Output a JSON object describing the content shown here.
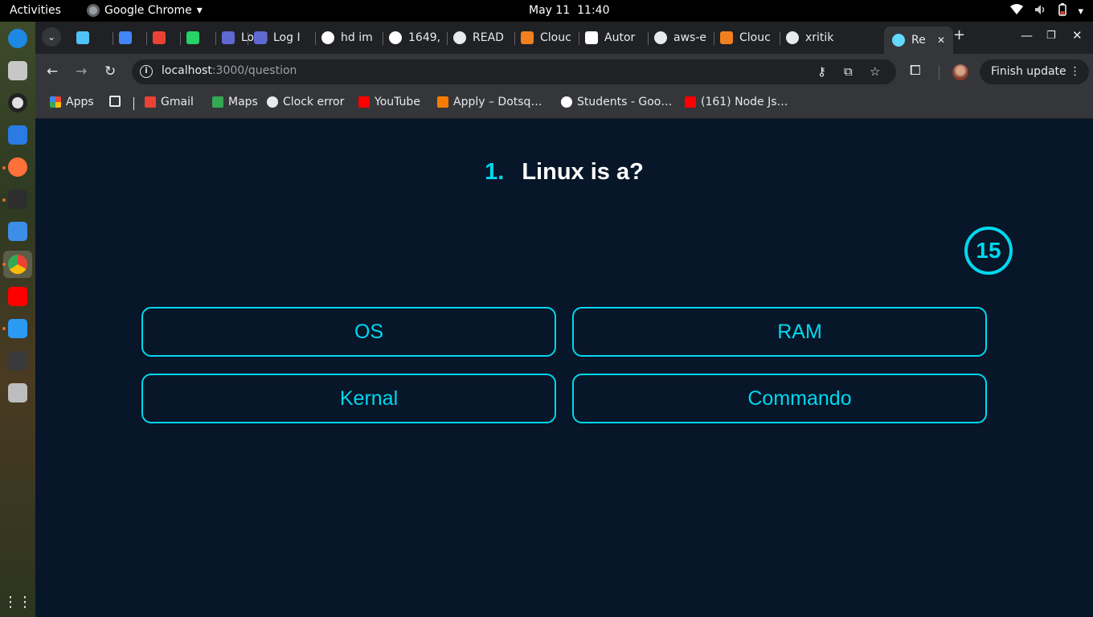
{
  "topbar": {
    "activities": "Activities",
    "app_name": "Google Chrome",
    "date": "May 11",
    "time": "11:40"
  },
  "tabs": [
    {
      "label": "",
      "icon": "weather-icon",
      "color": "#4fc3f7"
    },
    {
      "label": "",
      "icon": "calendar-icon",
      "color": "#4285f4"
    },
    {
      "label": "",
      "icon": "gmail-icon",
      "color": "#ea4335"
    },
    {
      "label": "",
      "icon": "whatsapp-icon",
      "color": "#25d366"
    },
    {
      "label": "Log I",
      "icon": "linear-icon",
      "color": "#5e6ad2"
    },
    {
      "label": "Log I",
      "icon": "linear-icon",
      "color": "#5e6ad2"
    },
    {
      "label": "hd im",
      "icon": "google-icon",
      "color": "#ffffff"
    },
    {
      "label": "1649,",
      "icon": "google-icon",
      "color": "#ffffff"
    },
    {
      "label": "READ",
      "icon": "openai-icon",
      "color": "#e8eaed"
    },
    {
      "label": "Clouc",
      "icon": "cloudflare-icon",
      "color": "#f38020"
    },
    {
      "label": "Autor",
      "icon": "medium-icon",
      "color": "#ffffff"
    },
    {
      "label": "aws-e",
      "icon": "github-icon",
      "color": "#e8eaed"
    },
    {
      "label": "Clouc",
      "icon": "cloudflare-icon",
      "color": "#f38020"
    },
    {
      "label": "xritik",
      "icon": "github-icon",
      "color": "#e8eaed"
    },
    {
      "label": "Re",
      "icon": "react-icon",
      "color": "#61dafb"
    }
  ],
  "toolbar": {
    "url_host": "localhost",
    "url_path": ":3000/question",
    "finish_update": "Finish update"
  },
  "bookmarks": [
    {
      "label": "Apps",
      "icon": "apps-grid-icon"
    },
    {
      "label": "",
      "icon": "tab-groups-icon"
    },
    {
      "label": "Gmail",
      "icon": "gmail-icon"
    },
    {
      "label": "Maps",
      "icon": "maps-icon"
    },
    {
      "label": "Clock error",
      "icon": "globe-icon"
    },
    {
      "label": "YouTube",
      "icon": "youtube-icon"
    },
    {
      "label": "Apply – Dotsq…",
      "icon": "dotsquares-icon"
    },
    {
      "label": "Students - Goo…",
      "icon": "google-icon"
    },
    {
      "label": "(161) Node Js…",
      "icon": "youtube-icon"
    }
  ],
  "quiz": {
    "question_number": "1.",
    "question_text": "Linux is a?",
    "timer": "15",
    "options": [
      "OS",
      "RAM",
      "Kernal",
      "Commando"
    ],
    "accent_color": "#00d8ee",
    "background_color": "#071628"
  }
}
